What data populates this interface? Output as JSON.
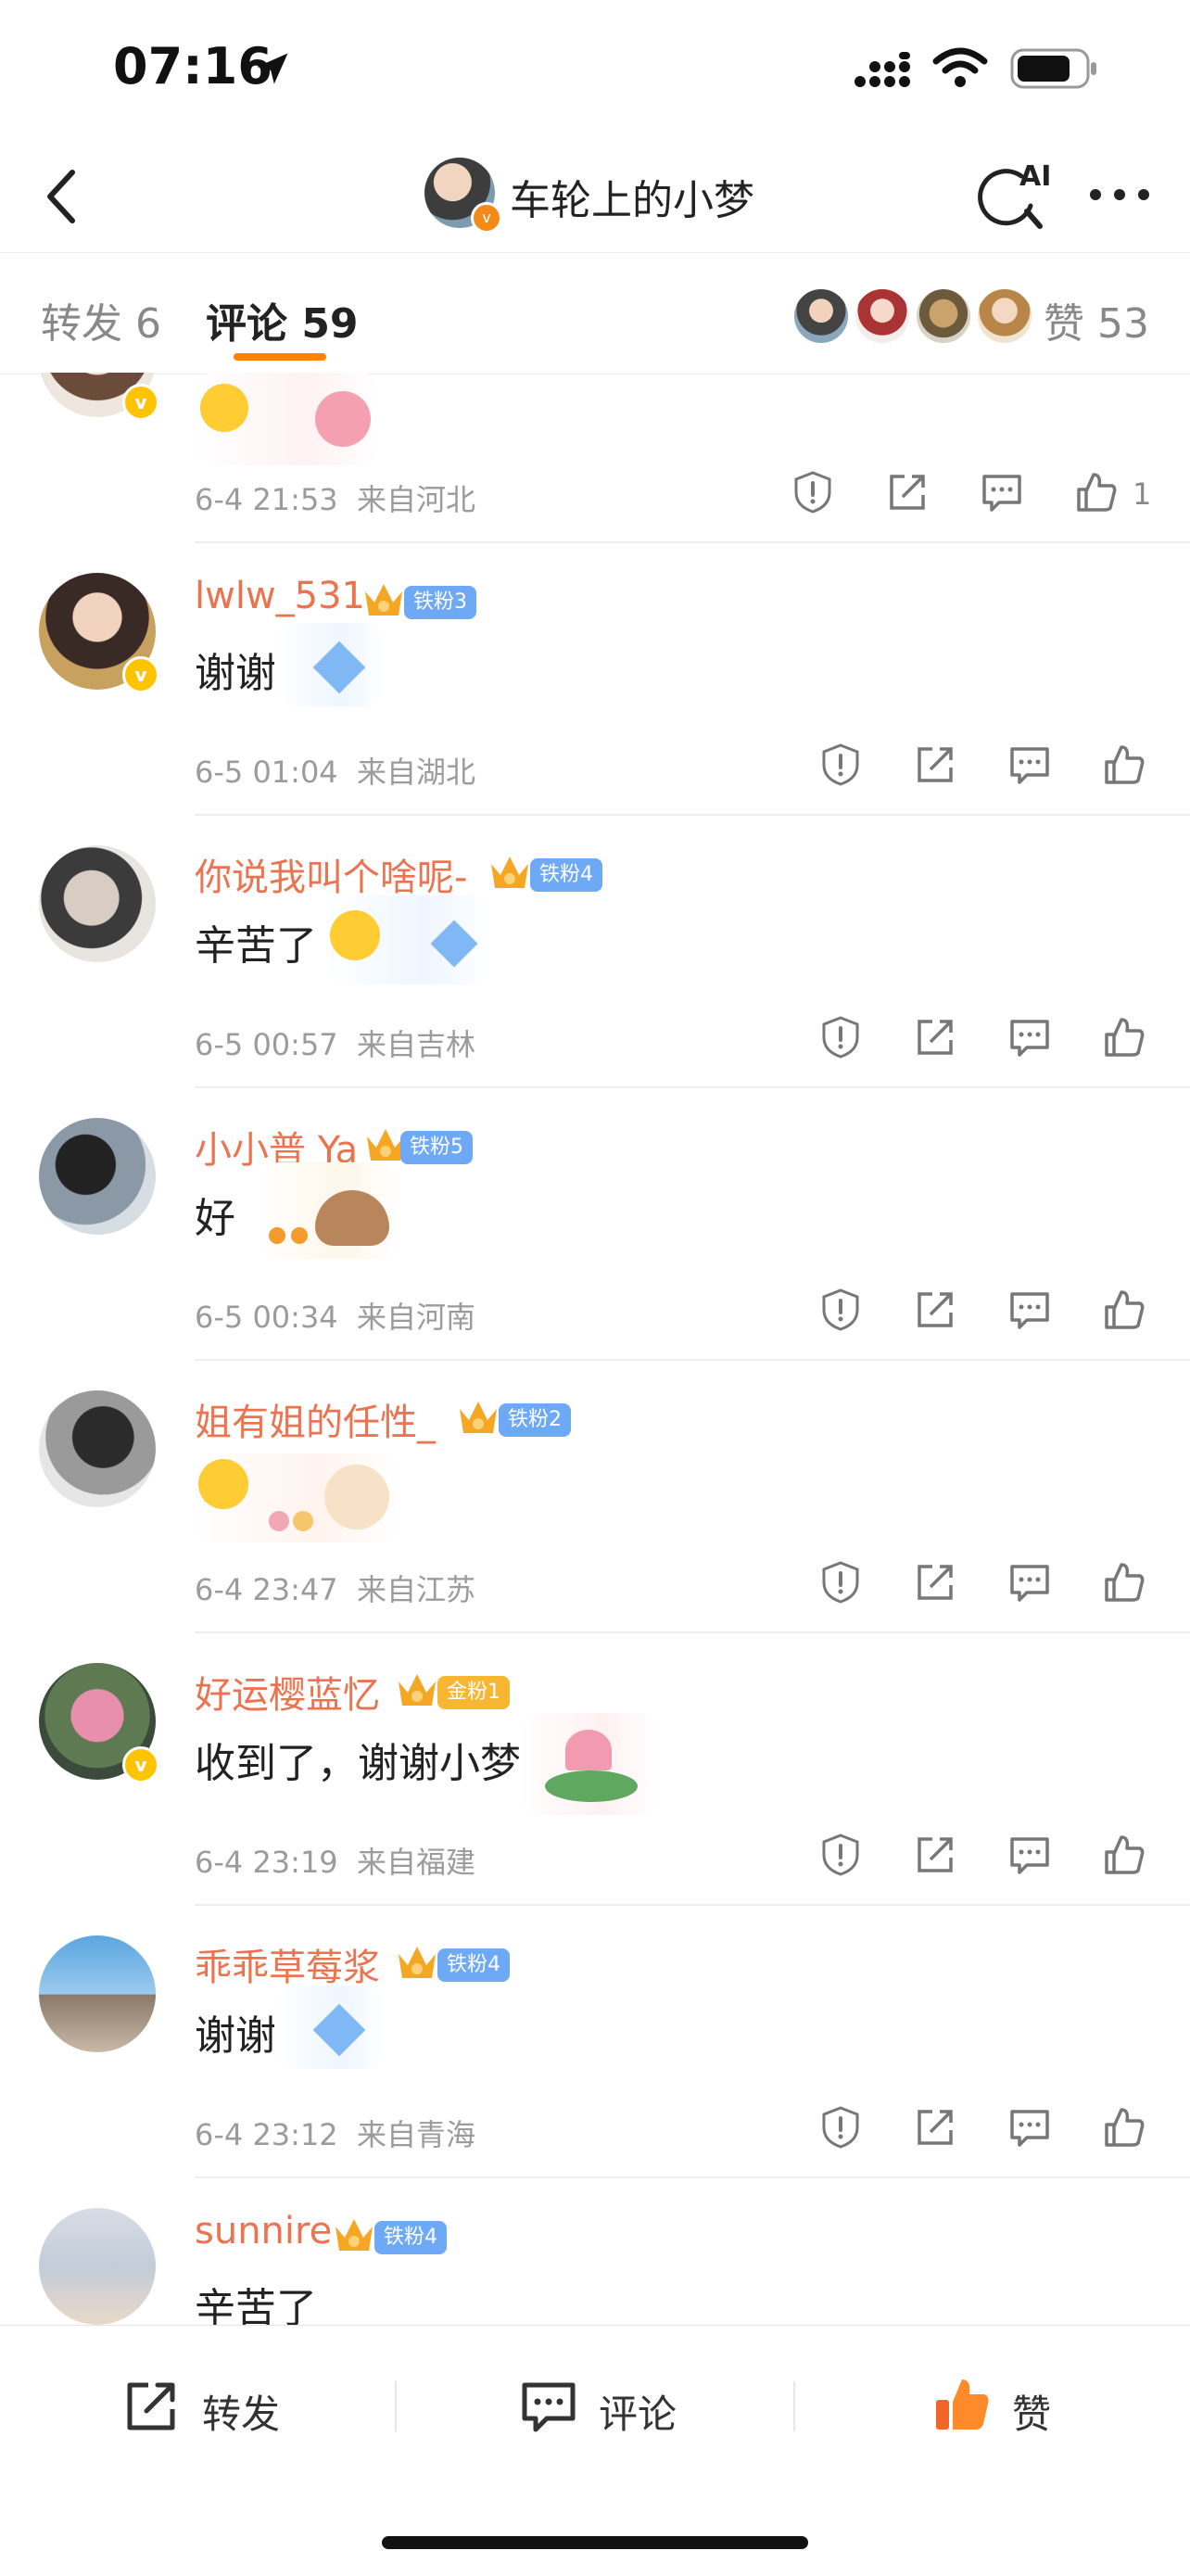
{
  "status_bar": {
    "time": "07:16"
  },
  "nav": {
    "title": "车轮上的小梦",
    "ai_label": "AI"
  },
  "tabs": {
    "repost": "转发 6",
    "comment": "评论 59",
    "likes": "赞 53"
  },
  "comments": [
    {
      "name": "",
      "text": "",
      "date": "6-4 21:53",
      "location": "来自河北",
      "like_count": "1",
      "verified": true
    },
    {
      "name": "lwlw_531",
      "fan_badge": "铁粉3",
      "crown_level": "4",
      "text": "谢谢",
      "date": "6-5 01:04",
      "location": "来自湖北",
      "verified": true
    },
    {
      "name": "你说我叫个啥呢-",
      "fan_badge": "铁粉4",
      "crown_level": "2",
      "text": "辛苦了",
      "date": "6-5 00:57",
      "location": "来自吉林"
    },
    {
      "name": "小小普 Ya",
      "fan_badge": "铁粉5",
      "crown_level": "",
      "text": "好",
      "date": "6-5 00:34",
      "location": "来自河南"
    },
    {
      "name": "姐有姐的任性_",
      "fan_badge": "铁粉2",
      "crown_level": "2",
      "text": "",
      "date": "6-4 23:47",
      "location": "来自江苏"
    },
    {
      "name": "好运樱蓝忆",
      "fan_badge": "金粉1",
      "crown_level": "4",
      "text": "收到了，谢谢小梦",
      "date": "6-4 23:19",
      "location": "来自福建",
      "verified": true
    },
    {
      "name": "乖乖草莓浆",
      "fan_badge": "铁粉4",
      "crown_level": "3",
      "text": "谢谢",
      "date": "6-4 23:12",
      "location": "来自青海"
    },
    {
      "name": "sunnire",
      "fan_badge": "铁粉4",
      "crown_level": "2",
      "text": "辛苦了",
      "date": "",
      "location": ""
    }
  ],
  "toolbar": {
    "repost": "转发",
    "comment": "评论",
    "like": "赞"
  },
  "colors": {
    "accent": "#ff8200",
    "username": "#eb7350",
    "meta": "#9b9b9b"
  },
  "icons": [
    "location-arrow-icon",
    "signal-icon",
    "wifi-icon",
    "battery-icon",
    "back-arrow-icon",
    "ai-search-icon",
    "more-icon",
    "report-icon",
    "share-icon",
    "reply-icon",
    "like-icon",
    "crown-icon"
  ]
}
